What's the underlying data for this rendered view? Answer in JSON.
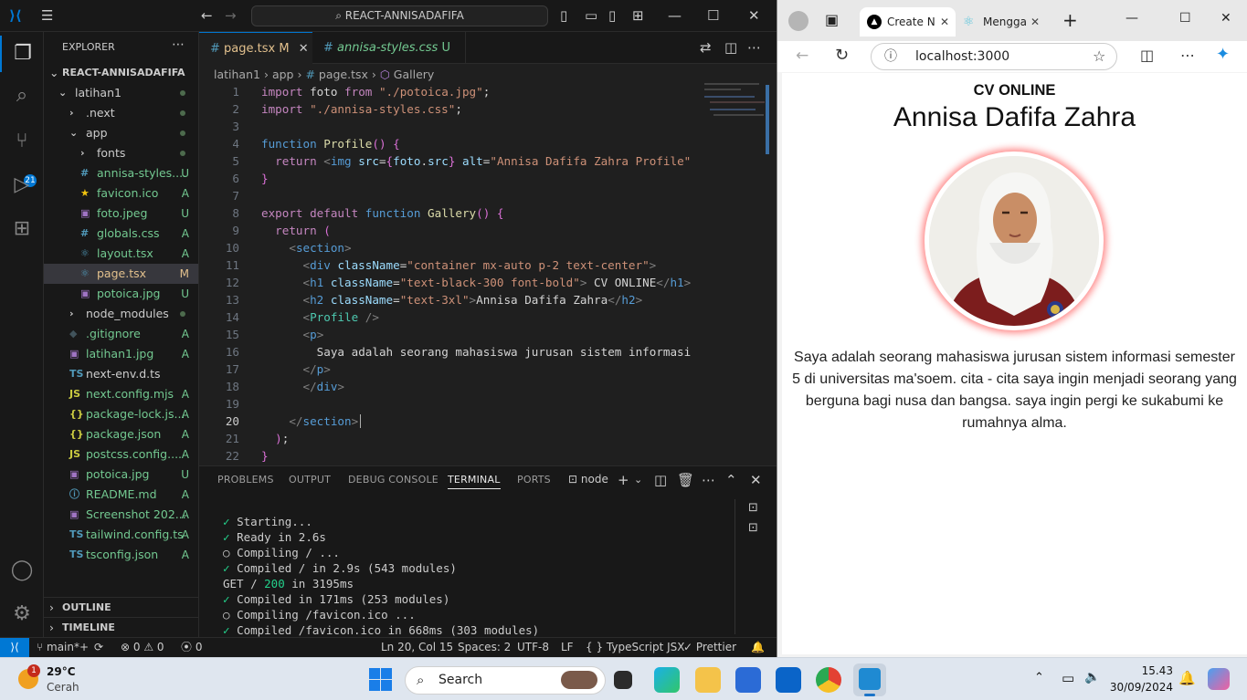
{
  "vscode": {
    "command_center": "REACT-ANNISADAFIFA",
    "sidebar": {
      "header": "EXPLORER",
      "root": "REACT-ANNISADAFIFA",
      "items": [
        {
          "label": "latihan1",
          "status": "",
          "indent": 1,
          "kind": "folder-open"
        },
        {
          "label": ".next",
          "status": "",
          "indent": 2,
          "kind": "folder"
        },
        {
          "label": "app",
          "status": "",
          "indent": 2,
          "kind": "folder-open"
        },
        {
          "label": "fonts",
          "status": "",
          "indent": 3,
          "kind": "folder"
        },
        {
          "label": "annisa-styles....",
          "status": "U",
          "indent": 3,
          "kind": "css"
        },
        {
          "label": "favicon.ico",
          "status": "A",
          "indent": 3,
          "kind": "star"
        },
        {
          "label": "foto.jpeg",
          "status": "U",
          "indent": 3,
          "kind": "img"
        },
        {
          "label": "globals.css",
          "status": "A",
          "indent": 3,
          "kind": "css"
        },
        {
          "label": "layout.tsx",
          "status": "A",
          "indent": 3,
          "kind": "react"
        },
        {
          "label": "page.tsx",
          "status": "M",
          "indent": 3,
          "kind": "react"
        },
        {
          "label": "potoica.jpg",
          "status": "U",
          "indent": 3,
          "kind": "img"
        },
        {
          "label": "node_modules",
          "status": "",
          "indent": 2,
          "kind": "folder"
        },
        {
          "label": ".gitignore",
          "status": "A",
          "indent": 2,
          "kind": "git"
        },
        {
          "label": "latihan1.jpg",
          "status": "A",
          "indent": 2,
          "kind": "img"
        },
        {
          "label": "next-env.d.ts",
          "status": "",
          "indent": 2,
          "kind": "ts"
        },
        {
          "label": "next.config.mjs",
          "status": "A",
          "indent": 2,
          "kind": "js"
        },
        {
          "label": "package-lock.js...",
          "status": "A",
          "indent": 2,
          "kind": "json"
        },
        {
          "label": "package.json",
          "status": "A",
          "indent": 2,
          "kind": "json"
        },
        {
          "label": "postcss.config....",
          "status": "A",
          "indent": 2,
          "kind": "js"
        },
        {
          "label": "potoica.jpg",
          "status": "U",
          "indent": 2,
          "kind": "img"
        },
        {
          "label": "README.md",
          "status": "A",
          "indent": 2,
          "kind": "info"
        },
        {
          "label": "Screenshot 202...",
          "status": "A",
          "indent": 2,
          "kind": "img"
        },
        {
          "label": "tailwind.config.ts",
          "status": "A",
          "indent": 2,
          "kind": "ts"
        },
        {
          "label": "tsconfig.json",
          "status": "A",
          "indent": 2,
          "kind": "ts"
        }
      ],
      "outline": "OUTLINE",
      "timeline": "TIMELINE"
    },
    "tabs": [
      {
        "label": "page.tsx",
        "status": "M",
        "icon": "#"
      },
      {
        "label": "annisa-styles.css",
        "status": "U",
        "icon": "#"
      }
    ],
    "breadcrumb": [
      "latihan1",
      "app",
      "page.tsx",
      "Gallery"
    ],
    "line_numbers": [
      "1",
      "2",
      "3",
      "4",
      "5",
      "6",
      "7",
      "8",
      "9",
      "10",
      "11",
      "12",
      "13",
      "14",
      "15",
      "16",
      "17",
      "18",
      "19",
      "20",
      "21",
      "22"
    ],
    "code_lines": [
      "import foto from \"./potoica.jpg\";",
      "import \"./annisa-styles.css\";",
      "",
      "function Profile() {",
      "  return <img src={foto.src} alt=\"Annisa Dafifa Zahra Profile\"",
      "}",
      "",
      "export default function Gallery() {",
      "  return (",
      "    <section>",
      "      <div className=\"container mx-auto p-2 text-center\">",
      "      <h1 className=\"text-black-300 font-bold\"> CV ONLINE</h1>",
      "      <h2 className=\"text-3xl\">Annisa Dafifa Zahra</h2>",
      "      <Profile />",
      "      <p>",
      "        Saya adalah seorang mahasiswa jurusan sistem informasi",
      "      </p>",
      "      </div>",
      "",
      "    </section>",
      "  );",
      "}"
    ],
    "panel_tabs": [
      "PROBLEMS",
      "OUTPUT",
      "DEBUG CONSOLE",
      "TERMINAL",
      "PORTS"
    ],
    "terminal_name": "node",
    "terminal_lines": [
      {
        "mark": "✓",
        "text": "Starting..."
      },
      {
        "mark": "✓",
        "text": "Ready in 2.6s"
      },
      {
        "mark": "○",
        "text": "Compiling / ..."
      },
      {
        "mark": "✓",
        "text": "Compiled / in 2.9s (543 modules)"
      },
      {
        "mark": "",
        "text": "GET / ",
        "code": "200",
        "rest": " in 3195ms"
      },
      {
        "mark": "✓",
        "text": "Compiled in 171ms (253 modules)"
      },
      {
        "mark": "○",
        "text": "Compiling /favicon.ico ..."
      },
      {
        "mark": "✓",
        "text": "Compiled /favicon.ico in 668ms (303 modules)"
      }
    ],
    "status": {
      "branch": "main*+",
      "errors": "0",
      "warnings": "0",
      "ports": "0",
      "position": "Ln 20, Col 15",
      "spaces": "Spaces: 2",
      "encoding": "UTF-8",
      "eol": "LF",
      "language": "TypeScript JSX",
      "formatter": "Prettier"
    }
  },
  "browser": {
    "tabs": [
      {
        "label": "Create N"
      },
      {
        "label": "Mengga"
      }
    ],
    "url": "localhost:3000",
    "page": {
      "title": "CV ONLINE",
      "name": "Annisa Dafifa Zahra",
      "paragraph": "Saya adalah seorang mahasiswa jurusan sistem informasi semester 5 di universitas ma'soem. cita - cita saya ingin menjadi seorang yang berguna bagi nusa dan bangsa. saya ingin pergi ke sukabumi ke rumahnya alma."
    }
  },
  "taskbar": {
    "weather_temp": "29°C",
    "weather_desc": "Cerah",
    "weather_badge": "1",
    "search_placeholder": "Search",
    "time": "15.43",
    "date": "30/09/2024"
  },
  "colors": {
    "accent": "#0078d4",
    "git_added": "#73c991",
    "git_modified": "#e2c08d",
    "glow": "#ff8a8a"
  }
}
